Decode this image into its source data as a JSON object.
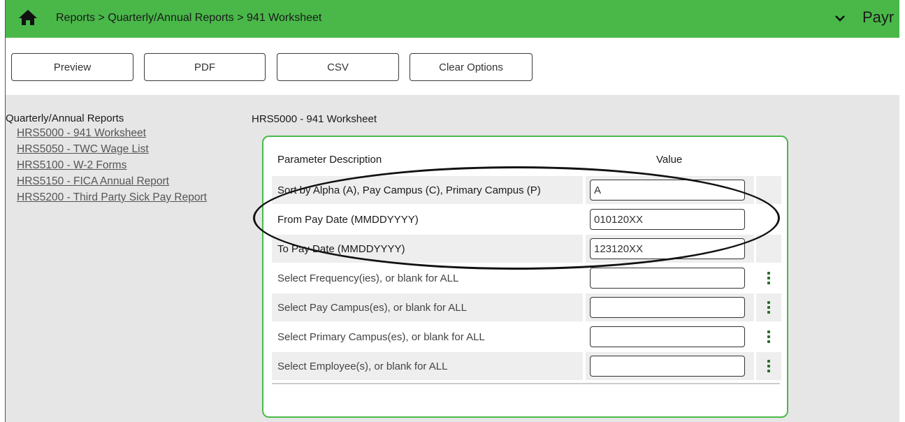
{
  "header": {
    "breadcrumb": "Reports > Quarterly/Annual Reports > 941 Worksheet",
    "app_name": "Payr",
    "icons": [
      "home-icon",
      "chevron-down-icon"
    ],
    "bg_color": "#49b849"
  },
  "toolbar": {
    "preview": "Preview",
    "pdf": "PDF",
    "csv": "CSV",
    "clear": "Clear Options"
  },
  "sidebar": {
    "title": "Quarterly/Annual Reports",
    "links": [
      "HRS5000 - 941 Worksheet",
      "HRS5050 - TWC Wage List",
      "HRS5100 - W-2 Forms",
      "HRS5150 - FICA Annual Report",
      "HRS5200 - Third Party Sick Pay Report"
    ]
  },
  "panel": {
    "title": "HRS5000 - 941 Worksheet",
    "col_desc": "Parameter Description",
    "col_value": "Value",
    "rows": [
      {
        "label": "Sort by Alpha (A), Pay Campus (C), Primary Campus (P)",
        "value": "A"
      },
      {
        "label": "From Pay Date (MMDDYYYY)",
        "value": "010120XX"
      },
      {
        "label": "To Pay Date (MMDDYYYY)",
        "value": "123120XX"
      },
      {
        "label": "Select Frequency(ies), or blank for ALL",
        "value": ""
      },
      {
        "label": "Select Pay Campus(es), or blank for ALL",
        "value": ""
      },
      {
        "label": "Select Primary Campus(es), or blank for ALL",
        "value": ""
      },
      {
        "label": "Select Employee(s), or blank for ALL",
        "value": ""
      }
    ],
    "accent_color": "#49b849"
  }
}
